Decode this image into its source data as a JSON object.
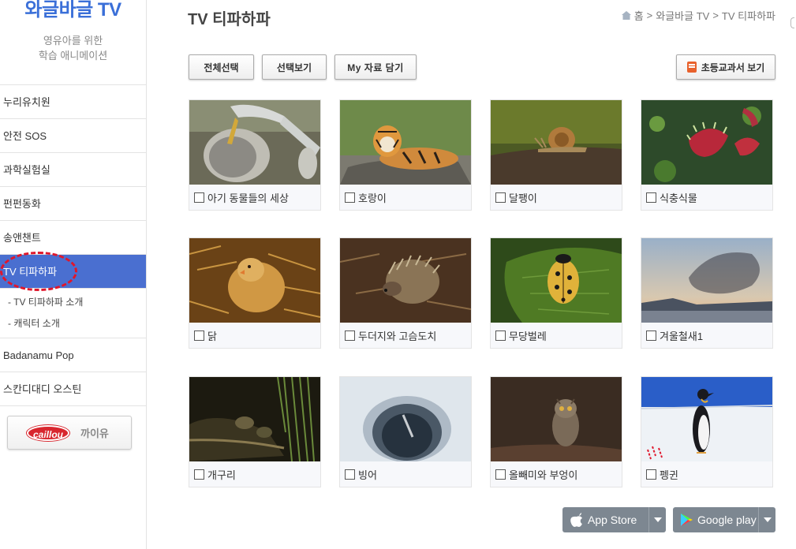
{
  "sidebar": {
    "brand_title": "와글바글 TV",
    "brand_sub_line1": "영유아를 위한",
    "brand_sub_line2": "학습 애니메이션",
    "items": [
      {
        "label": "누리유치원"
      },
      {
        "label": "안전 SOS"
      },
      {
        "label": "과학실험실"
      },
      {
        "label": "펀펀동화"
      },
      {
        "label": "송앤챈트"
      },
      {
        "label": "TV 티파하파"
      }
    ],
    "submenu": [
      {
        "label": "- TV 티파하파 소개"
      },
      {
        "label": "- 캐릭터 소개"
      }
    ],
    "items_after": [
      {
        "label": "Badanamu Pop"
      },
      {
        "label": "스칸디대디 오스틴"
      }
    ],
    "caillou_logo": "caillou",
    "caillou_label": "까이유"
  },
  "header": {
    "title": "TV 티파하파",
    "breadcrumb": [
      "홈",
      "와글바글 TV",
      "TV 티파하파"
    ],
    "separator": ">"
  },
  "toolbar": {
    "select_all": "전체선택",
    "view_selected": "선택보기",
    "my_data": "My 자료 담기",
    "textbook": "초등교과서 보기"
  },
  "videos": [
    {
      "title": "아기 동물들의 세상",
      "scene": "bird-chick"
    },
    {
      "title": "호랑이",
      "scene": "tiger"
    },
    {
      "title": "달팽이",
      "scene": "snail"
    },
    {
      "title": "식충식물",
      "scene": "venus-flytrap"
    },
    {
      "title": "닭",
      "scene": "chick"
    },
    {
      "title": "두더지와 고슴도치",
      "scene": "hedgehog"
    },
    {
      "title": "무당벌레",
      "scene": "ladybug"
    },
    {
      "title": "겨울철새1",
      "scene": "starling-flock"
    },
    {
      "title": "개구리",
      "scene": "frogs"
    },
    {
      "title": "빙어",
      "scene": "ice-hole"
    },
    {
      "title": "올빼미와 부엉이",
      "scene": "owl"
    },
    {
      "title": "펭귄",
      "scene": "penguin"
    }
  ],
  "stores": {
    "appstore": "App Store",
    "google": "Google play"
  },
  "colors": {
    "brand": "#3a6fd8",
    "active_menu": "#4a6fd0",
    "annotation_red": "#e0162b",
    "store_bg": "#7d8791"
  }
}
